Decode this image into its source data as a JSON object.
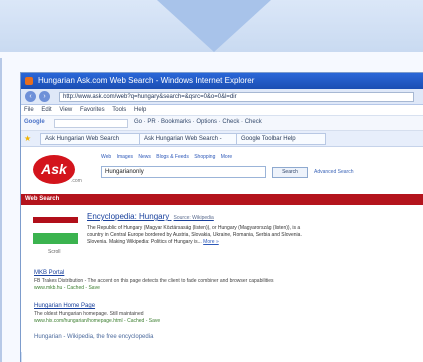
{
  "window": {
    "title": "Hungarian Ask.com Web Search - Windows Internet Explorer",
    "address": "http://www.ask.com/web?q=hungary&search=&qsrc=0&o=0&l=dir",
    "menu": [
      "File",
      "Edit",
      "View",
      "Favorites",
      "Tools",
      "Help"
    ]
  },
  "toolbar": {
    "google_label": "Google",
    "tools_text": "Go · PR · Bookmarks · Options · Check · Check"
  },
  "tabs": [
    "Ask Hungarian Web Search",
    "Ask Hungarian Web Search -",
    "Google Toolbar Help"
  ],
  "ask_page": {
    "logo": "Ask",
    "logo_sub": ".com",
    "search_tabs": [
      "Web",
      "Images",
      "News",
      "Blogs & Feeds",
      "Shopping",
      "More"
    ],
    "query": "Hungarianonly",
    "search_button": "Search",
    "advanced_link": "Advanced Search",
    "web_search_label": "Web Search"
  },
  "results": {
    "green_label": "Scroll",
    "primary_title": "Encyclopedia: Hungary",
    "primary_title_sub": "Source: Wikipedia",
    "primary_lines": [
      "The Republic of Hungary (Magyar Köztársaság (listen)), or Hungary (Magyarország (listen)), is a",
      "country in Central Europe bordered by Austria, Slovakia, Ukraine, Romania, Serbia and Slovenia.",
      "Slovenia. Making Wikipedia: Politics of Hungary is..."
    ],
    "more_link": "More »",
    "second_title": "MKB Portal",
    "second_line": "FB Trakes Distribution - The accent on this page detects the client to fade combiner and browser capabilities",
    "second_url": "www.mkb.hu - Cached - Save",
    "third_title": "Hungarian Home Page",
    "third_line": "The oldest Hungarian homepage. Still maintained",
    "third_url": "www.hix.com/hungarian/homepage.html - Cached - Save",
    "fourth_title": "Hungarian - Wikipedia, the free encyclopedia"
  },
  "colors": {
    "banner": "#c9daf1",
    "arrow": "#a8c3ea",
    "ask_red": "#b4141d",
    "result_green": "#3bb34f"
  }
}
